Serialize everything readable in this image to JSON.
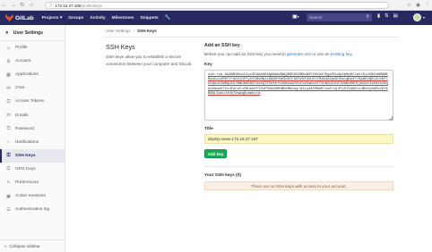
{
  "browser": {
    "url_host": "172.16.47.180",
    "url_path": "/profile/keys"
  },
  "header": {
    "brand": "GitLab",
    "nav": [
      "Projects",
      "Groups",
      "Activity",
      "Milestones",
      "Snippets"
    ],
    "search_placeholder": "Search"
  },
  "sidebar": {
    "title": "User Settings",
    "items": [
      {
        "label": "Profile",
        "icon": "profile-icon"
      },
      {
        "label": "Account",
        "icon": "account-icon"
      },
      {
        "label": "Applications",
        "icon": "applications-icon"
      },
      {
        "label": "Chat",
        "icon": "chat-icon"
      },
      {
        "label": "Access Tokens",
        "icon": "key-icon"
      },
      {
        "label": "Emails",
        "icon": "envelope-icon"
      },
      {
        "label": "Password",
        "icon": "lock-icon"
      },
      {
        "label": "Notifications",
        "icon": "bell-icon"
      },
      {
        "label": "SSH Keys",
        "icon": "ssh-key-icon"
      },
      {
        "label": "GPG Keys",
        "icon": "gpg-key-icon"
      },
      {
        "label": "Preferences",
        "icon": "sliders-icon"
      },
      {
        "label": "Active Sessions",
        "icon": "sessions-icon"
      },
      {
        "label": "Authentication log",
        "icon": "log-icon"
      }
    ],
    "active_index": 8,
    "collapse_label": "Collapse sidebar"
  },
  "breadcrumb": {
    "parent": "User Settings",
    "current": "SSH Keys"
  },
  "intro": {
    "title": "SSH Keys",
    "description": "SSH keys allow you to establish a secure connection between your computer and GitLab."
  },
  "form": {
    "heading": "Add an SSH key",
    "desc_prefix": "Before you can add an SSH key you need to ",
    "desc_link1": "generate one",
    "desc_mid": " or use an ",
    "desc_link2": "existing key",
    "desc_suffix": ".",
    "key_label": "Key",
    "key_value": "ssh-rsa AAAAB3NzaC1yc2EAAAADAQABAAABAQDDK9V9MAzN6TVeDu97Eg4SSu3p4pRp8ClekY9i4IB8JWR6WEMpu5z1eRHYY+kEUjhFfyhYGBs0WJz96NH+Ne5bDIF9ZSzNf3dUUlTMiB4A3uU9lEwlgKeX7rNpAHvQECZcnHflSGqkuCZmRQu1s+RmUKeD6X7osXQTT5zXn+b2GKcumYXnfVzEqNcdfTGhHVuZtOZlNhBrKKUFjmZwT4iKhVtiRqkbS8we0TZxdYkCzFufNhohEFYSoFRkG9ORHBDeMbksq+aIiyAAfRW6R7uo0+dj2Fy5ISdG9lcdBv0yhWFhCKYKBRALSunuJxUhTVwwq@lamkira",
    "title_label": "Title",
    "title_value": "deploy-www-172.16.47.167",
    "add_button": "Add key",
    "your_keys": "Your SSH keys (0)",
    "no_keys": "There are no SSH keys with access to your account."
  }
}
